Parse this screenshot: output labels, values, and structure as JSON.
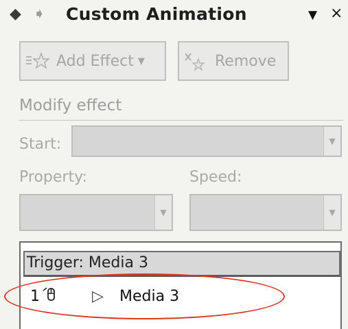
{
  "header": {
    "back_glyph": "◆",
    "forward_glyph": "➧",
    "title": "Custom Animation",
    "dropdown_glyph": "▼",
    "close_glyph": "×"
  },
  "toolbar": {
    "add_effect_label": "Add Effect",
    "add_effect_caret": "▼",
    "remove_label": "Remove"
  },
  "modify": {
    "section_title": "Modify effect",
    "start_label": "Start:",
    "property_label": "Property:",
    "speed_label": "Speed:",
    "combo_arrow": "▼"
  },
  "list": {
    "trigger_label": "Trigger: Media 3",
    "items": [
      {
        "index": "1",
        "play_glyph": "▷",
        "name": "Media 3"
      }
    ]
  },
  "colors": {
    "highlight": "#e0321f",
    "disabled_text": "#a6a6a6"
  }
}
